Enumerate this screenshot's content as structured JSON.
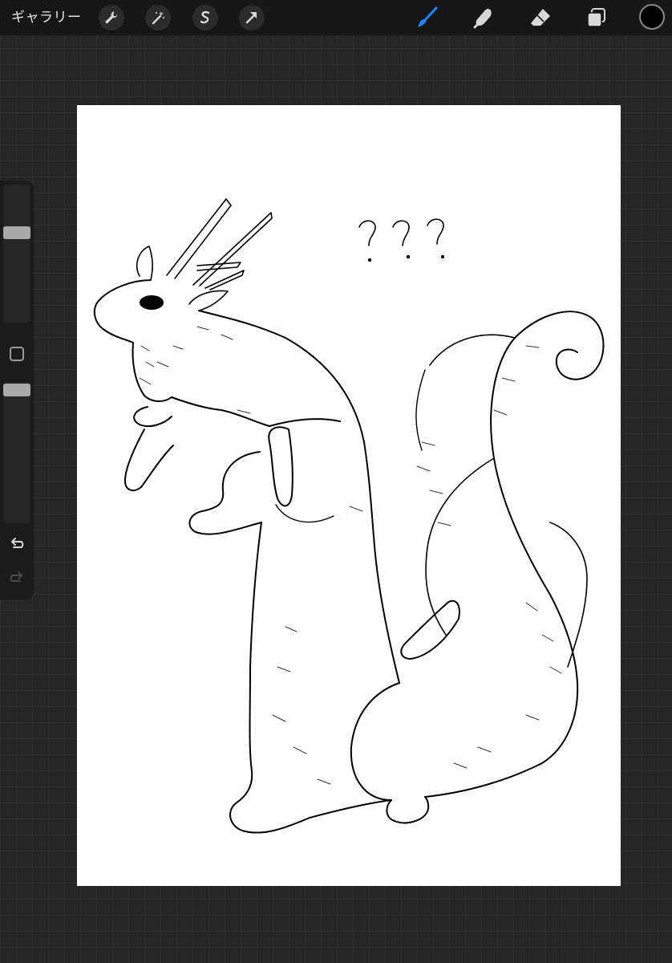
{
  "toolbar": {
    "gallery_label": "ギャラリー",
    "left_tools": [
      {
        "name": "actions",
        "icon": "wrench-icon"
      },
      {
        "name": "adjustments",
        "icon": "magic-wand-icon"
      },
      {
        "name": "selection",
        "icon": "selection-s-icon"
      },
      {
        "name": "transform",
        "icon": "arrow-cursor-icon"
      }
    ],
    "right_tools": [
      {
        "name": "brush",
        "icon": "brush-icon",
        "active": true
      },
      {
        "name": "smudge",
        "icon": "smudge-finger-icon",
        "active": false
      },
      {
        "name": "eraser",
        "icon": "eraser-icon",
        "active": false
      },
      {
        "name": "layers",
        "icon": "layers-icon",
        "active": false
      }
    ],
    "current_color": "#000000",
    "active_tool_color": "#1e88ff"
  },
  "sidebar": {
    "brush_size_level": 0.67,
    "opacity_level": 1.0,
    "modify_button": "square-icon",
    "undo_icon": "undo-icon",
    "redo_icon": "redo-icon",
    "redo_enabled": false
  },
  "canvas": {
    "background": "#ffffff",
    "drawing": "line-art-jackalope-squirrel-with-antlers",
    "annotation": "???"
  },
  "colors": {
    "toolbar_bg": "#161616",
    "workspace_bg": "#262626",
    "icon_color": "#d8d8d8"
  }
}
